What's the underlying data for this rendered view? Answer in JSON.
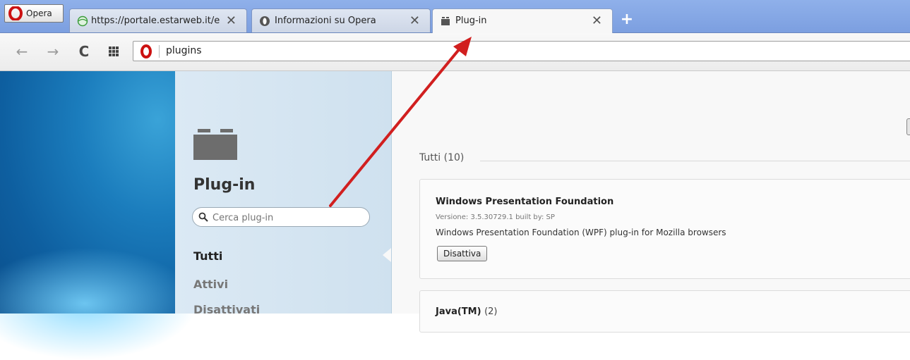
{
  "browser": {
    "menu_label": "Opera",
    "tabs": [
      {
        "title": "https://portale.estarweb.it/e",
        "icon": "globe-icon",
        "active": false
      },
      {
        "title": "Informazioni su Opera",
        "icon": "opera-icon",
        "active": false
      },
      {
        "title": "Plug-in",
        "icon": "plugin-icon",
        "active": true
      }
    ],
    "close_symbol": "✕",
    "new_tab_symbol": "+",
    "address": "plugins"
  },
  "nav_icons": {
    "back": "back-arrow-icon",
    "forward": "forward-arrow-icon",
    "reload": "reload-icon",
    "speed_dial": "speed-dial-icon"
  },
  "sidebar": {
    "title": "Plug-in",
    "search_placeholder": "Cerca plug-in",
    "links": [
      {
        "label": "Tutti",
        "selected": true
      },
      {
        "label": "Attivi",
        "selected": false
      },
      {
        "label": "Disattivati",
        "selected": false
      }
    ]
  },
  "main": {
    "section_heading": "Tutti (10)",
    "plugins": [
      {
        "name": "Windows Presentation Foundation",
        "version": "Versione: 3.5.30729.1 built by: SP",
        "description": "Windows Presentation Foundation (WPF) plug-in for Mozilla browsers",
        "button_label": "Disattiva"
      },
      {
        "name": "Java(TM)",
        "count": "(2)"
      }
    ]
  },
  "colors": {
    "accent_arrow": "#d11f1f",
    "tabbar": "#8fb0ea",
    "sidebar": "#d6e6f2"
  }
}
